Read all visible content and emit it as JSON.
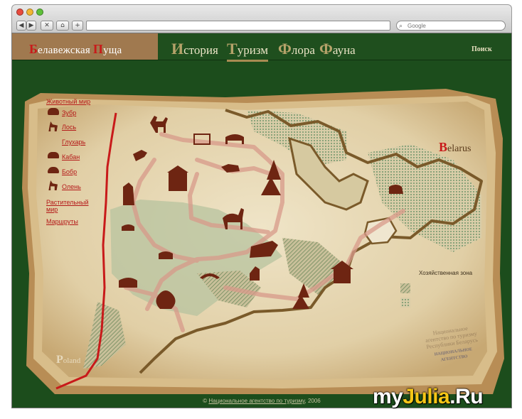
{
  "browser": {
    "search_placeholder": "Google",
    "nav_back": "◀",
    "nav_forward": "▶",
    "nav_stop": "✕",
    "nav_home": "⌂",
    "nav_add": "+"
  },
  "site": {
    "logo": {
      "cap1": "Б",
      "rest1": "елавежская ",
      "cap2": "П",
      "rest2": "уща"
    },
    "menu": [
      {
        "cap": "И",
        "rest": "стория"
      },
      {
        "cap": "Т",
        "rest": "уризм"
      },
      {
        "cap": "Ф",
        "rest": "лора"
      },
      {
        "cap": "Ф",
        "rest": "ауна"
      }
    ],
    "search_link": "Поиск"
  },
  "sidebar": [
    "Животный мир",
    "Зубр",
    "Лось",
    "Глухарь",
    "Кабан",
    "Бобр",
    "Олень",
    "Растительный мир",
    "Маршруты"
  ],
  "map": {
    "country_cap": "B",
    "country_rest": "elarus",
    "poland_cap": "P",
    "poland_rest": "oland",
    "legend": "Хозяйственная зона",
    "stamp": "Национальное агентство по туризму Республики Беларусь",
    "stamp_brand": "НАЦИОНАЛЬНОЕ АГЕНТСТВО"
  },
  "footer": {
    "copy": "© ",
    "link": "Национальное агентство по туризму",
    "year": ", 2006"
  },
  "watermark": {
    "a": "my",
    "b": "Julia",
    "c": ".Ru"
  },
  "colors": {
    "page_green": "#1c4d1c",
    "logo_tan": "#a0794f",
    "border_red": "#c81a1a",
    "map_parchment": "#e6d8b6",
    "forest_green": "#8fa77d",
    "link_red": "#b41818"
  }
}
